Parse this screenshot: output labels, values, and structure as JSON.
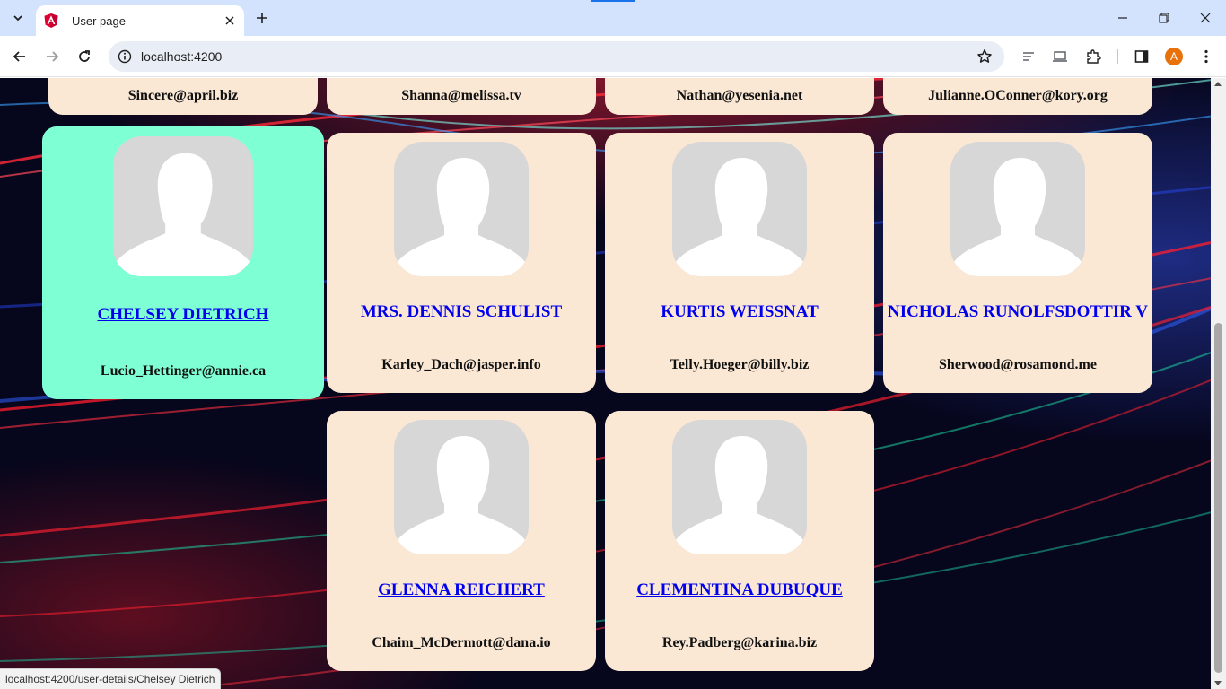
{
  "browser": {
    "tab_title": "User page",
    "url": "localhost:4200",
    "profile_initial": "A",
    "status_url": "localhost:4200/user-details/Chelsey Dietrich",
    "accent_color": "#1a73e8",
    "profile_color": "#e8710a"
  },
  "users_partial_row": [
    {
      "email": "Sincere@april.biz"
    },
    {
      "email": "Shanna@melissa.tv"
    },
    {
      "email": "Nathan@yesenia.net"
    },
    {
      "email": "Julianne.OConner@kory.org"
    }
  ],
  "users_row2": [
    {
      "name": "CHELSEY DIETRICH",
      "email": "Lucio_Hettinger@annie.ca",
      "selected": true
    },
    {
      "name": "MRS. DENNIS SCHULIST",
      "email": "Karley_Dach@jasper.info"
    },
    {
      "name": "KURTIS WEISSNAT",
      "email": "Telly.Hoeger@billy.biz"
    },
    {
      "name": "NICHOLAS RUNOLFSDOTTIR V",
      "email": "Sherwood@rosamond.me"
    }
  ],
  "users_row3": [
    {
      "name": "GLENNA REICHERT",
      "email": "Chaim_McDermott@dana.io"
    },
    {
      "name": "CLEMENTINA DUBUQUE",
      "email": "Rey.Padberg@karina.biz"
    }
  ],
  "colors": {
    "card_bg": "#fae8d4",
    "card_selected_bg": "#7fffd4",
    "link_color": "#0000ee"
  }
}
